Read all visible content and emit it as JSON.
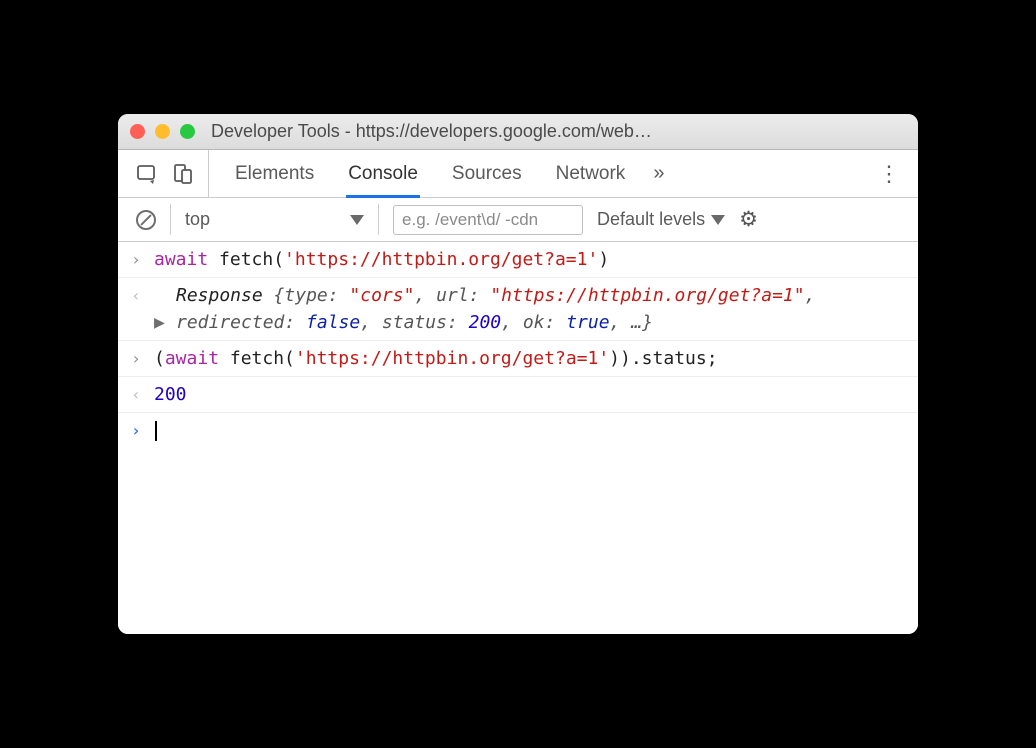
{
  "window": {
    "title": "Developer Tools - https://developers.google.com/web…"
  },
  "tabs": {
    "items": [
      "Elements",
      "Console",
      "Sources",
      "Network"
    ],
    "active": 1,
    "overflow": "»",
    "kebab": "⋮"
  },
  "toolbar": {
    "context": "top",
    "filter_placeholder": "e.g. /event\\d/ -cdn",
    "levels": "Default levels"
  },
  "console": {
    "rows": [
      {
        "kind": "input",
        "icon": "›",
        "code": {
          "await": "await",
          "func": " fetch(",
          "arg": "'https://httpbin.org/get?a=1'",
          "close": ")"
        }
      },
      {
        "kind": "output-object",
        "icon": "‹",
        "expander": "▶",
        "objname": "Response ",
        "obrace": "{",
        "p1k": "type: ",
        "p1v": "\"cors\"",
        "c1": ", ",
        "p2k": "url: ",
        "p2v": "\"https://httpbin.org/get?a=1\"",
        "c2": ", ",
        "p3k": "redirected: ",
        "p3v": "false",
        "c3": ", ",
        "p4k": "status: ",
        "p4v": "200",
        "c4": ", ",
        "p5k": "ok: ",
        "p5v": "true",
        "c5": ", …",
        "cbrace": "}"
      },
      {
        "kind": "input",
        "icon": "›",
        "code": {
          "open": "(",
          "await": "await",
          "func": " fetch(",
          "arg": "'https://httpbin.org/get?a=1'",
          "close": ")).status;"
        }
      },
      {
        "kind": "output-value",
        "icon": "‹",
        "value": "200"
      },
      {
        "kind": "prompt",
        "icon": "›"
      }
    ]
  }
}
